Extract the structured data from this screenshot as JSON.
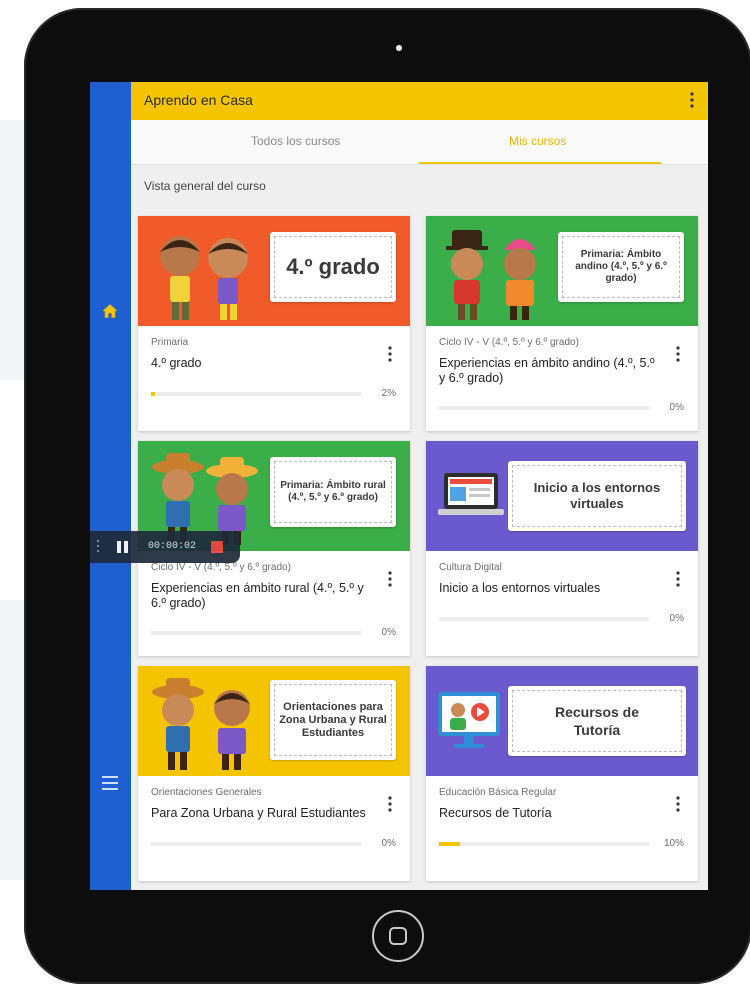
{
  "app": {
    "title": "Aprendo en Casa"
  },
  "tabs": [
    {
      "label": "Todos los cursos",
      "active": false
    },
    {
      "label": "Mis cursos",
      "active": true
    }
  ],
  "section_title": "Vista general del curso",
  "icons": {
    "home": "home-icon",
    "menu": "menu-icon",
    "more": "more-vert-icon"
  },
  "colors": {
    "accent_yellow": "#f5c400",
    "rail_blue": "#1f5fcf",
    "orange": "#f15b2a",
    "green": "#3bae49",
    "purple": "#6a5acd"
  },
  "courses": [
    {
      "banner_label": "4.º grado",
      "category": "Primaria",
      "name": "4.º grado",
      "progress_pct": 2,
      "progress_text": "2%"
    },
    {
      "banner_label": "Primaria: Ámbito andino (4.º, 5.º y 6.º grado)",
      "category": "Ciclo IV - V (4.º, 5.º y 6.º grado)",
      "name": "Experiencias en ámbito andino (4.º, 5.º y 6.º grado)",
      "progress_pct": 0,
      "progress_text": "0%"
    },
    {
      "banner_label": "Primaria: Ámbito rural (4.º, 5.º y 6.º grado)",
      "category": "Ciclo IV - V (4.º, 5.º y 6.º grado)",
      "name": "Experiencias en ámbito rural (4.º, 5.º y 6.º grado)",
      "progress_pct": 0,
      "progress_text": "0%"
    },
    {
      "banner_label": "Inicio a los entornos virtuales",
      "category": "Cultura Digital",
      "name": "Inicio a los entornos virtuales",
      "progress_pct": 0,
      "progress_text": "0%"
    },
    {
      "banner_label": "Orientaciones para Zona Urbana y Rural Estudiantes",
      "category": "Orientaciones Generales",
      "name": "Para Zona Urbana y Rural Estudiantes",
      "progress_pct": 0,
      "progress_text": "0%"
    },
    {
      "banner_label": "Recursos de Tutoría",
      "category": "Educación Básica Regular",
      "name": "Recursos de Tutoría",
      "progress_pct": 10,
      "progress_text": "10%"
    }
  ],
  "recorder": {
    "time": "00:00:02"
  }
}
